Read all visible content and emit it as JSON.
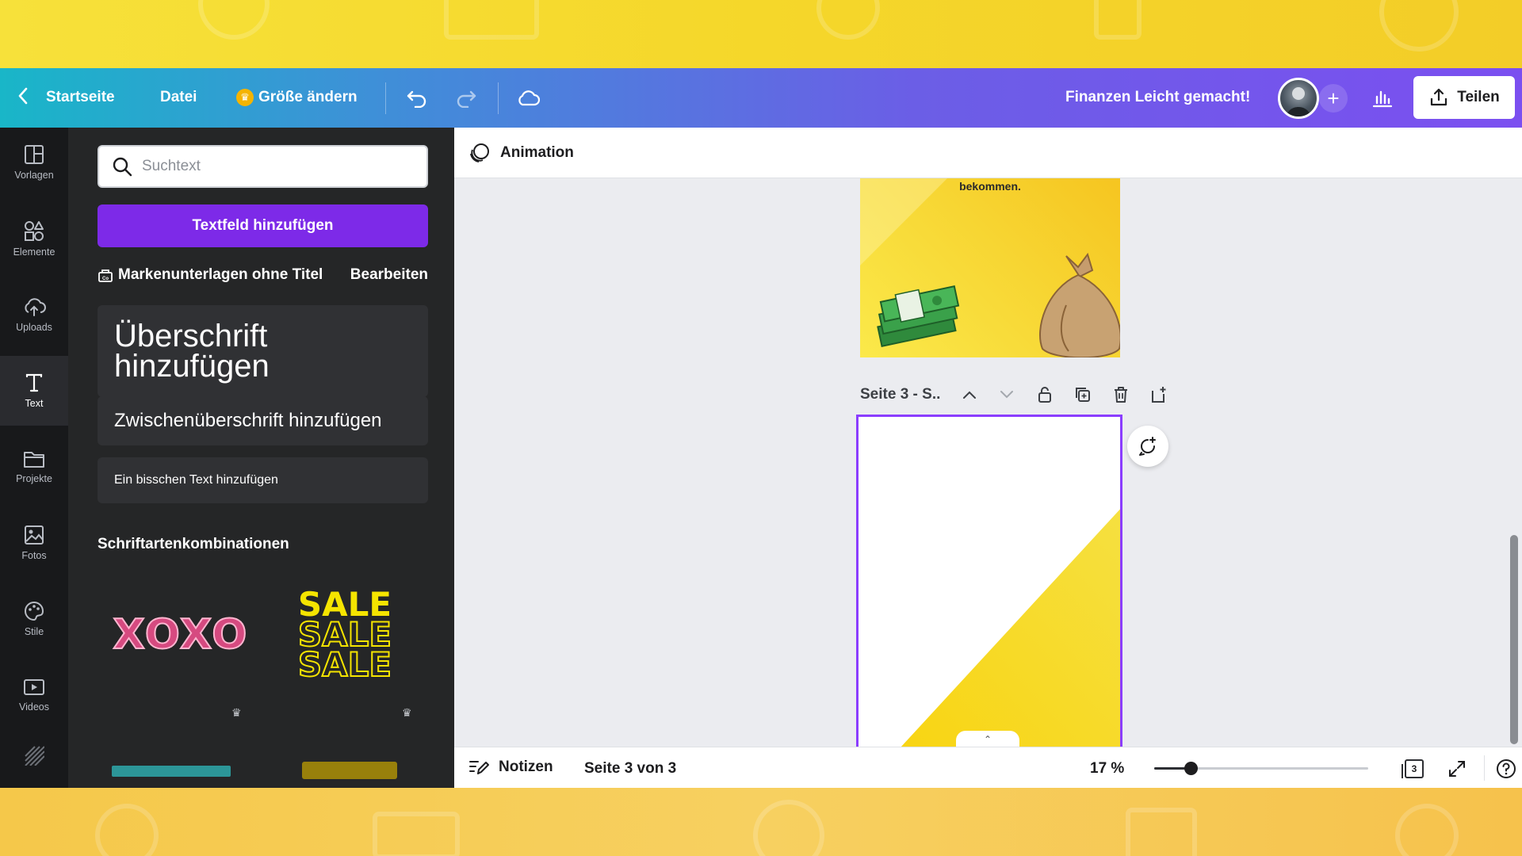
{
  "topbar": {
    "home_label": "Startseite",
    "file_label": "Datei",
    "resize_label": "Größe ändern",
    "project_title": "Finanzen Leicht gemacht!",
    "share_label": "Teilen"
  },
  "rail": {
    "items": [
      {
        "label": "Vorlagen",
        "icon": "templates-icon"
      },
      {
        "label": "Elemente",
        "icon": "elements-icon"
      },
      {
        "label": "Uploads",
        "icon": "upload-cloud-icon"
      },
      {
        "label": "Text",
        "icon": "text-icon"
      },
      {
        "label": "Projekte",
        "icon": "folder-icon"
      },
      {
        "label": "Fotos",
        "icon": "photo-icon"
      },
      {
        "label": "Stile",
        "icon": "palette-icon"
      },
      {
        "label": "Videos",
        "icon": "video-icon"
      }
    ],
    "active": "Text"
  },
  "panel": {
    "search_placeholder": "Suchtext",
    "add_textbox": "Textfeld hinzufügen",
    "brand_kit": "Markenunterlagen ohne Titel",
    "edit": "Bearbeiten",
    "heading": "Überschrift hinzufügen",
    "subheading": "Zwischenüberschrift hinzufügen",
    "body": "Ein bisschen Text hinzufügen",
    "combos_title": "Schriftartenkombinationen",
    "combo1": "XOXO",
    "combo2_line": "SALE"
  },
  "editor": {
    "animation_label": "Animation",
    "page2_text": "bekommen.",
    "page_label": "Seite 3 - S..",
    "notes_label": "Notizen",
    "page_indicator": "Seite 3 von 3",
    "zoom": "17 %",
    "zoom_fraction": 0.17,
    "page_count": "3"
  },
  "colors": {
    "accent_purple": "#7d2ae8",
    "selection": "#8b3dff",
    "brand_yellow": "#f5d320"
  }
}
